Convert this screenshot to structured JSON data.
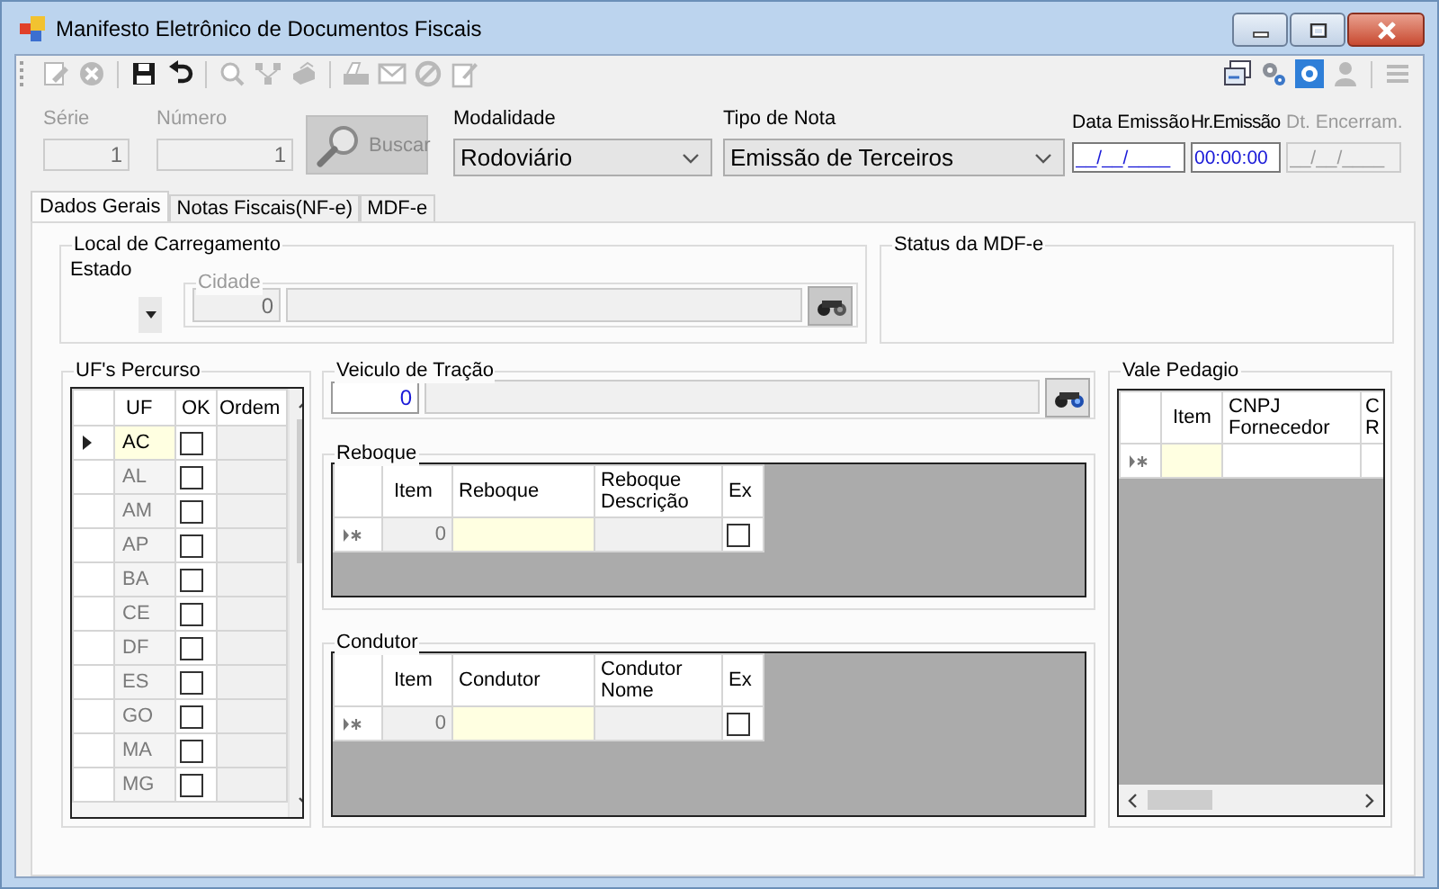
{
  "window": {
    "title": "Manifesto Eletrônico de Documentos Fiscais"
  },
  "toolbar": {
    "left": [
      {
        "kind": "edit",
        "disabled": true
      },
      {
        "kind": "cancel",
        "disabled": true
      },
      {
        "kind": "separator"
      },
      {
        "kind": "save",
        "disabled": false
      },
      {
        "kind": "undo",
        "disabled": false
      },
      {
        "kind": "separator"
      },
      {
        "kind": "search",
        "disabled": true
      },
      {
        "kind": "network",
        "disabled": true
      },
      {
        "kind": "printer",
        "disabled": true
      },
      {
        "kind": "separator"
      },
      {
        "kind": "scanner",
        "disabled": true
      },
      {
        "kind": "envelope",
        "disabled": true
      },
      {
        "kind": "block",
        "disabled": true
      },
      {
        "kind": "note",
        "disabled": true
      }
    ],
    "right": [
      {
        "kind": "windows",
        "disabled": false
      },
      {
        "kind": "gears",
        "disabled": false
      },
      {
        "kind": "help",
        "disabled": false
      },
      {
        "kind": "user",
        "disabled": true
      },
      {
        "kind": "separator"
      },
      {
        "kind": "menu",
        "disabled": true
      }
    ]
  },
  "header": {
    "serie": {
      "label": "Série",
      "value": "1",
      "disabled": true
    },
    "numero": {
      "label": "Número",
      "value": "1",
      "disabled": true
    },
    "buscar": {
      "label": "Buscar",
      "disabled": true
    },
    "modalidade": {
      "label": "Modalidade",
      "value": "Rodoviário"
    },
    "tipo_nota": {
      "label": "Tipo de Nota",
      "value": "Emissão de Terceiros"
    },
    "data_emissao": {
      "label": "Data Emissão",
      "value": "__/__/____",
      "disabled": false
    },
    "hr_emissao": {
      "label": "Hr.Emissão",
      "value": "00:00:00",
      "disabled": false
    },
    "dt_encerram": {
      "label": "Dt. Encerram.",
      "value": "__/__/____",
      "disabled": true
    }
  },
  "tabs": [
    {
      "label": "Dados Gerais",
      "selected": true
    },
    {
      "label": "Notas Fiscais(NF-e)",
      "selected": false
    },
    {
      "label": "MDF-e",
      "selected": false
    }
  ],
  "local_carregamento": {
    "title": "Local de Carregamento",
    "estado_label": "Estado",
    "cidade": {
      "title": "Cidade",
      "code": "0"
    }
  },
  "status": {
    "title": "Status da MDF-e"
  },
  "ufs_percurso": {
    "title": "UF's Percurso",
    "columns": [
      "UF",
      "OK",
      "Ordem"
    ],
    "rows": [
      {
        "uf": "AC",
        "ok": false,
        "current": true
      },
      {
        "uf": "AL",
        "ok": false,
        "current": false
      },
      {
        "uf": "AM",
        "ok": false,
        "current": false
      },
      {
        "uf": "AP",
        "ok": false,
        "current": false
      },
      {
        "uf": "BA",
        "ok": false,
        "current": false
      },
      {
        "uf": "CE",
        "ok": false,
        "current": false
      },
      {
        "uf": "DF",
        "ok": false,
        "current": false
      },
      {
        "uf": "ES",
        "ok": false,
        "current": false
      },
      {
        "uf": "GO",
        "ok": false,
        "current": false
      },
      {
        "uf": "MA",
        "ok": false,
        "current": false
      },
      {
        "uf": "MG",
        "ok": false,
        "current": false
      }
    ]
  },
  "veiculo": {
    "title": "Veiculo de Tração",
    "code": "0"
  },
  "reboque": {
    "title": "Reboque",
    "columns": [
      "Item",
      "Reboque",
      "Reboque Descrição",
      "Ex"
    ],
    "rows": [
      {
        "item": "0",
        "ex": false,
        "new": true
      }
    ]
  },
  "condutor": {
    "title": "Condutor",
    "columns": [
      "Item",
      "Condutor",
      "Condutor Nome",
      "Ex"
    ],
    "rows": [
      {
        "item": "0",
        "ex": false,
        "new": true
      }
    ]
  },
  "vale_pedagio": {
    "title": "Vale Pedagio",
    "columns": [
      "Item",
      "CNPJ Fornecedor",
      "C R"
    ],
    "rows": [
      {
        "new": true
      }
    ]
  }
}
